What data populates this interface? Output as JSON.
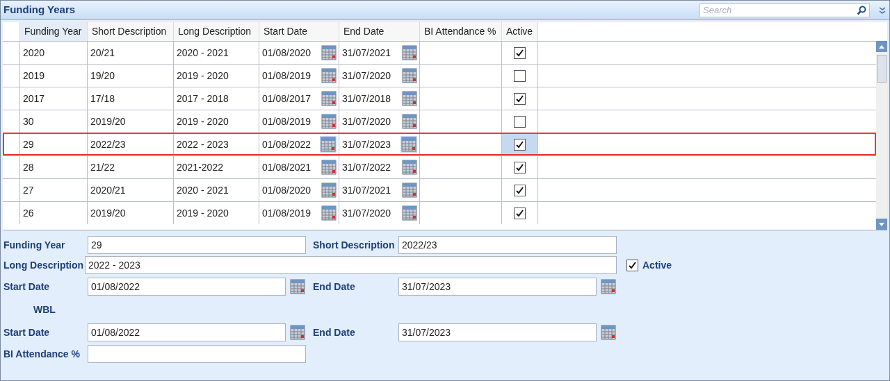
{
  "title": "Funding Years",
  "search": {
    "placeholder": "Search"
  },
  "table": {
    "columns": [
      "Funding Year",
      "Short Description",
      "Long Description",
      "Start Date",
      "End Date",
      "BI Attendance %",
      "Active"
    ],
    "rows": [
      {
        "funding_year": "2020",
        "short": "20/21",
        "long": "2020 - 2021",
        "start": "01/08/2020",
        "end": "31/07/2021",
        "active": true,
        "selected": false
      },
      {
        "funding_year": "2019",
        "short": "19/20",
        "long": "2019 - 2020",
        "start": "01/08/2019",
        "end": "31/07/2020",
        "active": false,
        "selected": false
      },
      {
        "funding_year": "2017",
        "short": "17/18",
        "long": "2017 - 2018",
        "start": "01/08/2017",
        "end": "31/07/2018",
        "active": true,
        "selected": false
      },
      {
        "funding_year": "30",
        "short": "2019/20",
        "long": "2019 - 2020",
        "start": "01/08/2019",
        "end": "31/07/2020",
        "active": false,
        "selected": false
      },
      {
        "funding_year": "29",
        "short": "2022/23",
        "long": "2022 - 2023",
        "start": "01/08/2022",
        "end": "31/07/2023",
        "active": true,
        "selected": true
      },
      {
        "funding_year": "28",
        "short": "21/22",
        "long": "2021-2022",
        "start": "01/08/2021",
        "end": "31/07/2022",
        "active": true,
        "selected": false
      },
      {
        "funding_year": "27",
        "short": "2020/21",
        "long": "2020 - 2021",
        "start": "01/08/2020",
        "end": "31/07/2021",
        "active": true,
        "selected": false
      },
      {
        "funding_year": "26",
        "short": "2019/20",
        "long": "2019 - 2020",
        "start": "01/08/2019",
        "end": "31/07/2020",
        "active": true,
        "selected": false
      }
    ]
  },
  "form": {
    "funding_year": {
      "label": "Funding Year",
      "value": "29"
    },
    "short_description": {
      "label": "Short Description",
      "value": "2022/23"
    },
    "long_description": {
      "label": "Long Description",
      "value": "2022 - 2023"
    },
    "active": {
      "label": "Active",
      "checked": true
    },
    "start_date": {
      "label": "Start Date",
      "value": "01/08/2022"
    },
    "end_date": {
      "label": "End Date",
      "value": "31/07/2023"
    },
    "wbl_heading": "WBL",
    "wbl_start_date": {
      "label": "Start Date",
      "value": "01/08/2022"
    },
    "wbl_end_date": {
      "label": "End Date",
      "value": "31/07/2023"
    },
    "bi_attendance": {
      "label": "BI Attendance %"
    }
  }
}
